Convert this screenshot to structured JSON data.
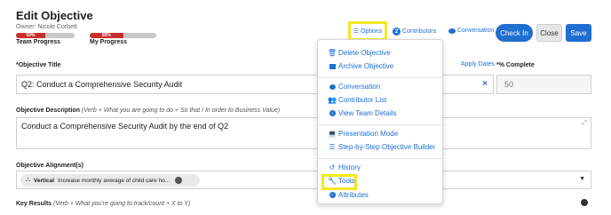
{
  "header": {
    "title": "Edit Objective",
    "owner": "Owner: Nicole Corbett",
    "team_progress_label": "Team Progress",
    "team_progress_value": "50%",
    "team_progress_fraction": 0.5,
    "my_progress_label": "My Progress",
    "my_progress_value": "50%",
    "my_progress_fraction": 0.5
  },
  "toolbar": {
    "options_label": "Options",
    "contributors_label": "Contributors",
    "contributors_count": "2",
    "conversation_label": "Conversation",
    "checkin_label": "Check In",
    "close_label": "Close",
    "save_label": "Save"
  },
  "form": {
    "objective_title_label": "*Objective Title",
    "apply_dates_label": "Apply Dates",
    "objective_title_value": "Q2: Conduct a Comprehensive Security Audit",
    "complete_label": "*% Complete",
    "complete_value": "50",
    "description_label": "Objective Description",
    "description_hint": "(Verb + What you are going to do + So that / In order to Business Value)",
    "description_value": "Conduct a Comprehensive Security Audit by the end of Q2",
    "alignment_label": "Objective Alignment(s)",
    "alignment_tag_bold": "Vertical",
    "alignment_tag_text": "Increase monthly average of child care ho...",
    "key_results_label": "Key Results",
    "key_results_hint": "(Verb + What you're going to track/count + X to Y)"
  },
  "menu": {
    "items": [
      {
        "label": "Delete Objective",
        "icon": "trash-icon"
      },
      {
        "label": "Archive Objective",
        "icon": "archive-icon"
      },
      {
        "label": "Conversation",
        "icon": "comment-icon"
      },
      {
        "label": "Contributor List",
        "icon": "users-icon"
      },
      {
        "label": "View Team Details",
        "icon": "info-icon"
      },
      {
        "label": "Presentation Mode",
        "icon": "laptop-icon"
      },
      {
        "label": "Step-by-Step Objective Builder",
        "icon": "sliders-icon"
      },
      {
        "label": "History",
        "icon": "history-icon"
      },
      {
        "label": "Tools",
        "icon": "wrench-icon"
      },
      {
        "label": "Attributes",
        "icon": "info-circle-icon"
      }
    ]
  },
  "colors": {
    "accent": "#1f6fd1",
    "progress_fill": "#c9302c",
    "highlight": "#f2ea22"
  }
}
